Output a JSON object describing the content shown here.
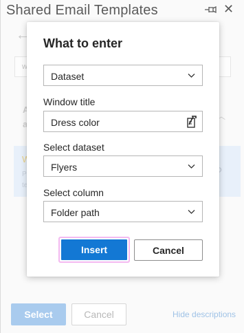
{
  "pane": {
    "title": "Shared Email Templates",
    "background_fragments": {
      "search_char": "w",
      "item_line1": "A",
      "item_line2": "a",
      "card_char": "W",
      "card_line1": "P",
      "card_line2": "te",
      "question_mark": "?"
    },
    "select_label": "Select",
    "cancel_label": "Cancel",
    "hide_descriptions_label": "Hide descriptions"
  },
  "dialog": {
    "title": "What to enter",
    "type_select": {
      "value": "Dataset"
    },
    "window_title": {
      "label": "Window title",
      "value": "Dress color"
    },
    "dataset": {
      "label": "Select dataset",
      "value": "Flyers"
    },
    "column": {
      "label": "Select column",
      "value": "Folder path"
    },
    "insert_label": "Insert",
    "cancel_label": "Cancel"
  },
  "colors": {
    "accent": "#1378d4",
    "focus_outline": "#f3b9f0",
    "dim_accent": "#a9cbee"
  }
}
